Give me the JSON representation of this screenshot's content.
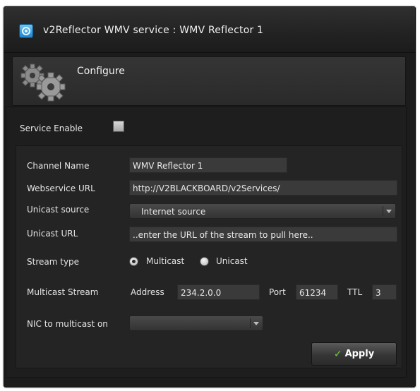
{
  "window": {
    "title": "v2Reflector WMV service : WMV Reflector 1",
    "app_icon": "v2-app-icon"
  },
  "configure": {
    "label": "Configure",
    "icon": "gears-icon"
  },
  "service_enable": {
    "label": "Service Enable",
    "checked": false
  },
  "form": {
    "channel_name": {
      "label": "Channel Name",
      "value": "WMV Reflector 1"
    },
    "webservice_url": {
      "label": "Webservice URL",
      "value": "http://V2BLACKBOARD/v2Services/"
    },
    "unicast_source": {
      "label": "Unicast source",
      "selected": "Internet source"
    },
    "unicast_url": {
      "label": "Unicast URL",
      "placeholder": "..enter the URL of the stream to pull here.."
    },
    "stream_type": {
      "label": "Stream type",
      "options": [
        "Multicast",
        "Unicast"
      ],
      "selected": "Multicast"
    },
    "multicast_stream": {
      "label": "Multicast Stream",
      "address_label": "Address",
      "address_value": "234.2.0.0",
      "port_label": "Port",
      "port_value": "61234",
      "ttl_label": "TTL",
      "ttl_value": "3"
    },
    "nic": {
      "label": "NIC to multicast on",
      "selected": ""
    }
  },
  "apply": {
    "label": "Apply"
  },
  "colors": {
    "accent_check": "#6ccf3a",
    "app_icon_blue": "#1a86cf"
  }
}
